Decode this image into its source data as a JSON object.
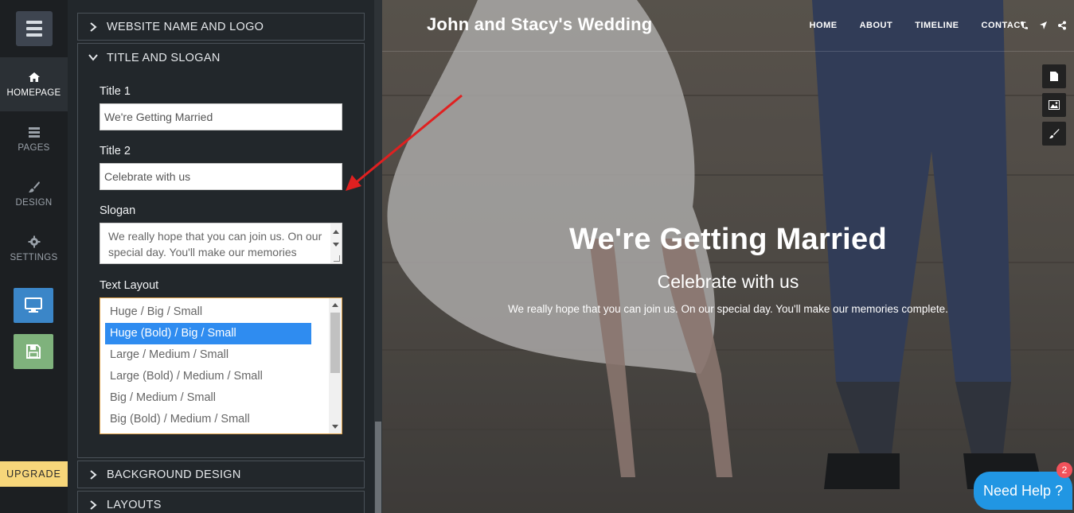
{
  "rail": {
    "items": [
      {
        "label": "HOMEPAGE",
        "icon": "home-icon",
        "active": true
      },
      {
        "label": "PAGES",
        "icon": "pages-icon"
      },
      {
        "label": "DESIGN",
        "icon": "brush-icon"
      },
      {
        "label": "SETTINGS",
        "icon": "gear-icon"
      }
    ],
    "upgrade_label": "UPGRADE"
  },
  "panel": {
    "sections": {
      "website": "WEBSITE NAME AND LOGO",
      "title": "TITLE AND SLOGAN",
      "background": "BACKGROUND DESIGN",
      "layouts": "LAYOUTS"
    },
    "fields": {
      "title1_label": "Title 1",
      "title1_value": "We're Getting Married",
      "title2_label": "Title 2",
      "title2_value": "Celebrate with us",
      "slogan_label": "Slogan",
      "slogan_value": "We really hope that you can join us. On our special day. You'll make our memories complete.",
      "layout_label": "Text Layout"
    },
    "layout_options": [
      "Huge / Big / Small",
      "Huge (Bold) / Big / Small",
      "Large / Medium / Small",
      "Large (Bold) / Medium / Small",
      "Big / Medium / Small",
      "Big (Bold) / Medium / Small"
    ],
    "selected_layout": "Huge (Bold) / Big / Small"
  },
  "preview": {
    "site_title": "John and Stacy's Wedding",
    "nav": [
      "HOME",
      "ABOUT",
      "TIMELINE",
      "CONTACT"
    ],
    "nav_icons": [
      "phone-icon",
      "location-icon",
      "share-icon"
    ],
    "side_tools": [
      "page-icon",
      "image-icon",
      "brush-icon"
    ],
    "hero_title": "We're Getting Married",
    "hero_subtitle": "Celebrate with us",
    "hero_slogan": "We really hope that you can join us. On our special day. You'll make our memories complete."
  },
  "help": {
    "label": "Need Help ?",
    "badge": "2"
  },
  "colors": {
    "preview_blue": "#3b86c8",
    "save_green": "#7fb27c",
    "upgrade_yellow": "#f7d67a",
    "help_blue": "#2196e3",
    "selection_blue": "#2f8cf0",
    "arrow_red": "#e02020"
  }
}
